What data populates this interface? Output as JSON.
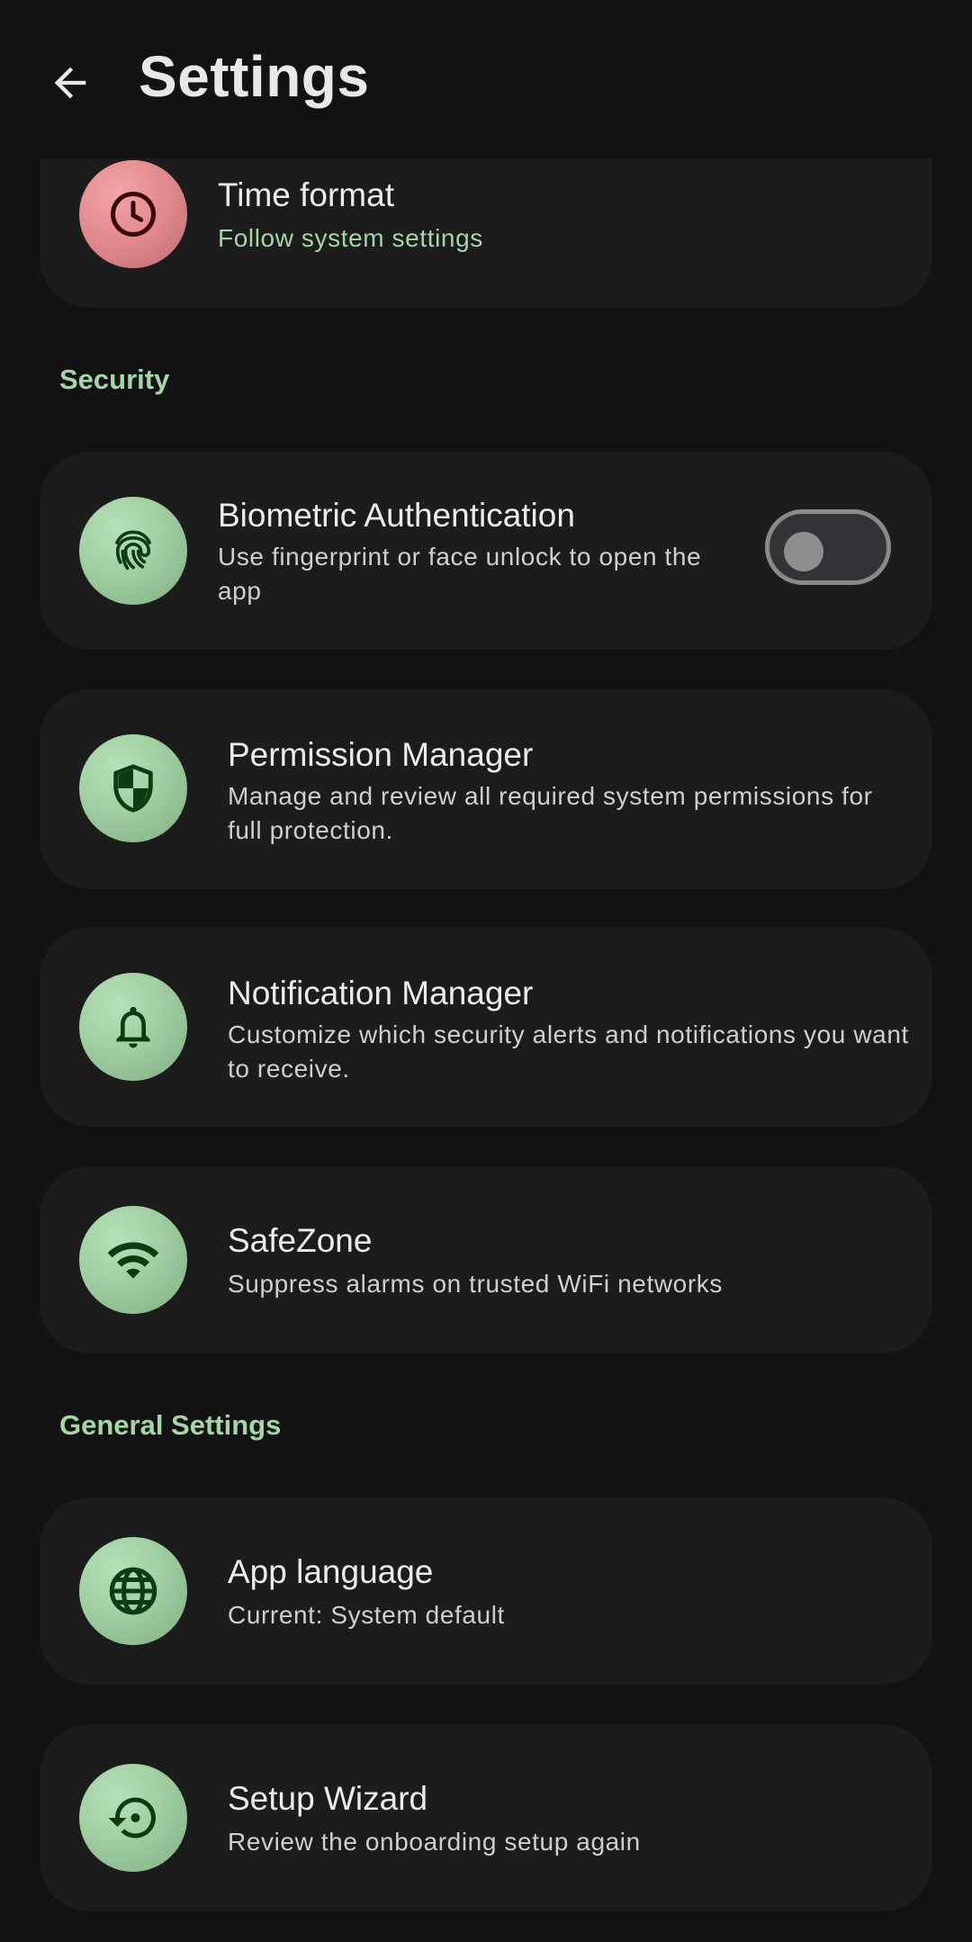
{
  "header": {
    "title": "Settings",
    "back_icon": "arrow-back-icon"
  },
  "time_format": {
    "title": "Time format",
    "subtitle": "Follow system settings",
    "icon": "clock-icon"
  },
  "sections": {
    "security": "Security",
    "general": "General Settings"
  },
  "biometric": {
    "title": "Biometric Authentication",
    "subtitle": "Use fingerprint or face unlock to open the app",
    "icon": "fingerprint-icon",
    "toggle_on": false
  },
  "permission": {
    "title": "Permission Manager",
    "subtitle": "Manage and review all required system permissions for full protection.",
    "icon": "shield-icon"
  },
  "notification": {
    "title": "Notification Manager",
    "subtitle": "Customize which security alerts and notifications you want to receive.",
    "icon": "bell-icon"
  },
  "safezone": {
    "title": "SafeZone",
    "subtitle": "Suppress alarms on trusted WiFi networks",
    "icon": "wifi-icon"
  },
  "language": {
    "title": "App language",
    "subtitle": "Current: System default",
    "icon": "globe-icon"
  },
  "wizard": {
    "title": "Setup Wizard",
    "subtitle": "Review the onboarding setup again",
    "icon": "restart-icon"
  },
  "colors": {
    "background": "#131313",
    "card": "#1c1c1c",
    "accent": "#a5d6a7",
    "icon_green": "#9fcfa1",
    "icon_red": "#e1898c",
    "icon_glyph_green": "#0f3a14",
    "icon_glyph_red": "#3a0608"
  }
}
